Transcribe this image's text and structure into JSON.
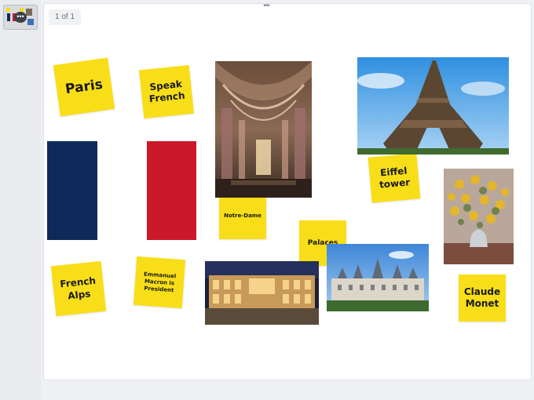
{
  "sidebar": {
    "slides": [
      {
        "thumbnail_label": "Slide 1",
        "menu_glyph": "•••"
      }
    ]
  },
  "board": {
    "page_indicator": "1 of 1",
    "drag_handle_glyph": "•••",
    "notes": [
      {
        "id": "paris",
        "text": "Paris",
        "color": "#f8de18"
      },
      {
        "id": "speak-french",
        "text": "Speak French",
        "color": "#f8de18"
      },
      {
        "id": "notre-dame",
        "text": "Notre-Dame",
        "color": "#f8de18"
      },
      {
        "id": "eiffel-tower",
        "text": "Eiffel tower",
        "color": "#f8de18"
      },
      {
        "id": "palaces",
        "text": "Palaces",
        "color": "#f8de18"
      },
      {
        "id": "french-alps",
        "text": "French Alps",
        "color": "#f8de18"
      },
      {
        "id": "macron",
        "text": "Emmanuel Macron is President",
        "color": "#f8de18"
      },
      {
        "id": "claude-monet",
        "text": "Claude Monet",
        "color": "#f8de18"
      }
    ],
    "flag_colors": {
      "blue": "#0f2a5a",
      "white": "#ffffff",
      "red": "#c9192a"
    },
    "photos": [
      {
        "id": "notre-dame-interior",
        "icon": "cathedral-photo"
      },
      {
        "id": "eiffel-tower",
        "icon": "eiffel-tower-photo"
      },
      {
        "id": "monet-painting",
        "icon": "flower-painting-photo"
      },
      {
        "id": "versailles",
        "icon": "palace-photo"
      },
      {
        "id": "chambord",
        "icon": "chateau-photo"
      }
    ]
  }
}
